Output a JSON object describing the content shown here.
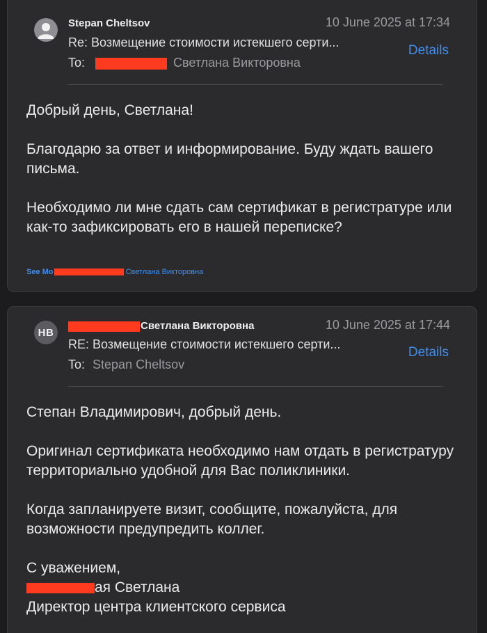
{
  "messages": [
    {
      "sender": "Stepan Cheltsov",
      "date": "10 June 2025 at 17:34",
      "subject": "Re: Возмещение стоимости истекшего серти...",
      "to_label": "To:",
      "to_name": "Светлана Викторовна",
      "details_label": "Details",
      "body": {
        "p1": "Добрый день, Светлана!",
        "p2": "Благодарю за ответ и информирование. Буду ждать вашего письма.",
        "p3": "Необходимо ли мне сдать сам сертификат в регистратуре или как-то зафиксировать его в нашей переписке?"
      },
      "see_more": {
        "label": "See Mo",
        "name": "Светлана Викторовна"
      },
      "avatar_icon": "person-icon"
    },
    {
      "avatar_initials": "HB",
      "sender": "Светлана Викторовна",
      "date": "10 June 2025 at 17:44",
      "subject": "RE: Возмещение стоимости истекшего серти...",
      "to_label": "To:",
      "to_name": "Stepan Cheltsov",
      "details_label": "Details",
      "body": {
        "p1": "Степан Владимирович, добрый день.",
        "p2": "Оригинал сертификата необходимо нам отдать в регистратуру территориально удобной для Вас поликлиники.",
        "p3": "Когда запланируете визит, сообщите, пожалуйста, для возможности предупредить коллег.",
        "sig1": "С уважением,",
        "sig2": "ая Светлана",
        "sig3": "Директор центра  клиентского сервиса"
      }
    }
  ],
  "colors": {
    "background": "#1c1c1e",
    "card": "#2b2b2d",
    "link": "#3f8ef0",
    "redaction": "#ff3b1f"
  }
}
